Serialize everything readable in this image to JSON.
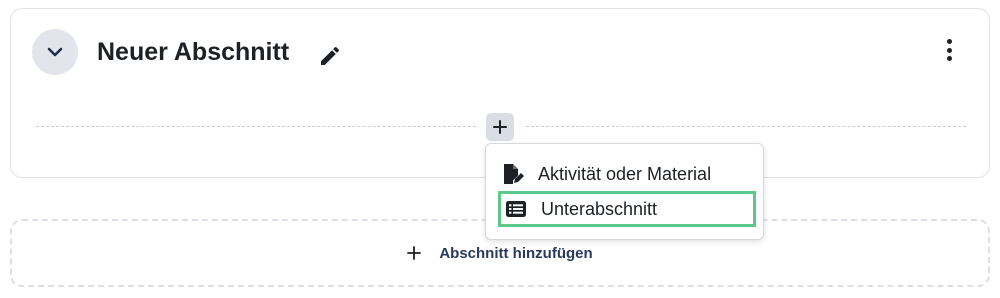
{
  "section": {
    "title": "Neuer Abschnitt",
    "collapse_icon": "chevron-down-icon",
    "edit_icon": "pencil-icon",
    "menu_icon": "kebab-vertical-icon",
    "add_icon": "plus-icon"
  },
  "dropdown": {
    "items": [
      {
        "label": "Aktivität oder Material",
        "icon": "file-pen-icon"
      },
      {
        "label": "Unterabschnitt",
        "icon": "list-icon",
        "highlighted": true
      }
    ]
  },
  "add_section": {
    "icon": "plus-icon",
    "label": "Abschnitt hinzufügen"
  },
  "colors": {
    "highlight_border": "#5cc98a",
    "button_bg": "#e2e6ec",
    "link_text": "#2a3a5e"
  }
}
